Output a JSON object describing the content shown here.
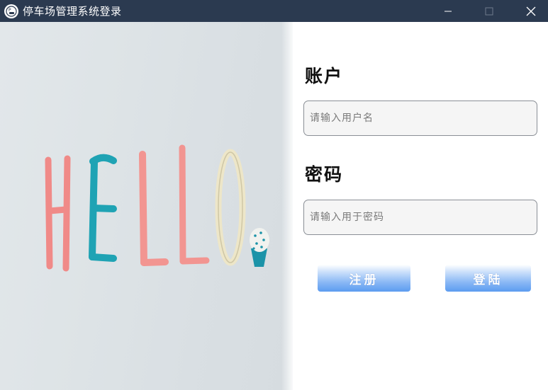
{
  "window": {
    "title": "停车场管理系统登录",
    "titlebar_color": "#2b3a50",
    "icons": {
      "app": "parking-app-icon",
      "minimize": "minimize-icon",
      "maximize": "maximize-icon",
      "close": "close-icon"
    }
  },
  "hero": {
    "image": "hello-painted-letters-photo",
    "painted_text": "HELLO"
  },
  "form": {
    "account_label": "账户",
    "account_placeholder": "请输入用户名",
    "account_value": "",
    "password_label": "密码",
    "password_placeholder": "请输入用于密码",
    "password_value": "",
    "register_label": "注册",
    "login_label": "登陆",
    "button_color": "#5c9cf0"
  }
}
